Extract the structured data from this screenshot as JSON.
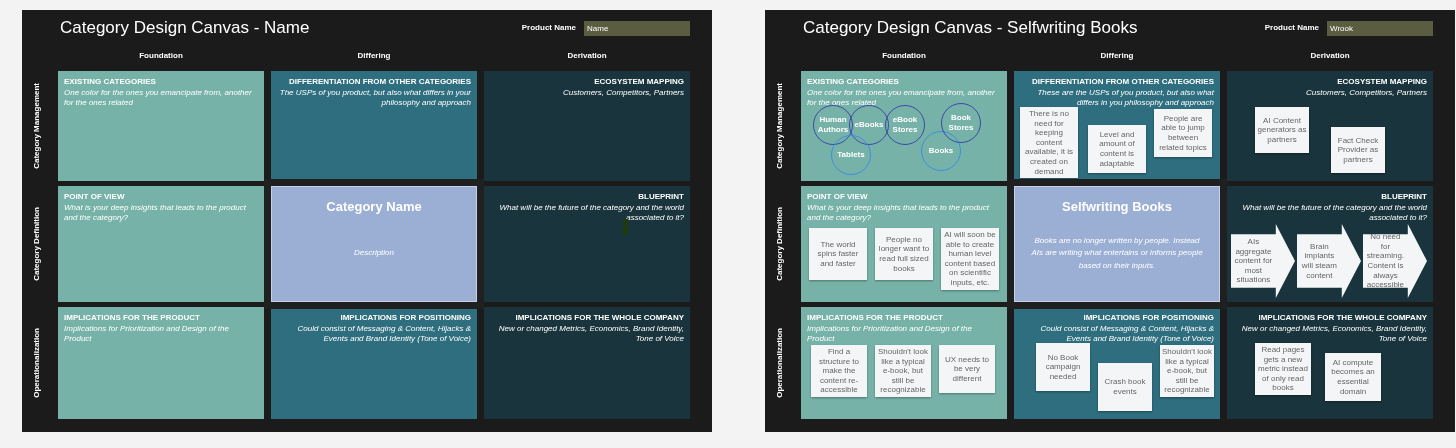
{
  "boards": [
    {
      "title": "Category Design Canvas - Name",
      "product_name": {
        "label": "Product Name",
        "value": "Name"
      },
      "columns": [
        "Foundation",
        "Differing",
        "Derivation"
      ],
      "rows": [
        {
          "label": "Category Management",
          "cells": [
            {
              "kind": "section",
              "title": "EXISTING CATEGORIES",
              "subtitle": "One color for the ones you emancipate from, another for the ones related"
            },
            {
              "kind": "section",
              "title": "DIFFERENTIATION FROM OTHER CATEGORIES",
              "subtitle": "The USPs of you product, but also what differs in your philosophy and approach"
            },
            {
              "kind": "section",
              "title": "ECOSYSTEM MAPPING",
              "subtitle": "Customers, Competitors, Partners"
            }
          ]
        },
        {
          "label": "Category Definition",
          "cells": [
            {
              "kind": "section",
              "title": "POINT OF VIEW",
              "subtitle": "What is your deep insights that leads to the product and the category?"
            },
            {
              "kind": "category",
              "name": "Category Name",
              "description": "Description"
            },
            {
              "kind": "section",
              "title": "BLUEPRINT",
              "subtitle": "What will be the future of the category and the world associated to it?",
              "marker": true
            }
          ]
        },
        {
          "label": "Operationalization",
          "cells": [
            {
              "kind": "section",
              "title": "IMPLICATIONS FOR THE PRODUCT",
              "subtitle": "Implications for Prioritization and Design of the Product"
            },
            {
              "kind": "section",
              "title": "IMPLICATIONS FOR POSITIONING",
              "subtitle": "Could consist of Messaging & Content, Hijacks & Events and Brand Identity (Tone of Voice)"
            },
            {
              "kind": "section",
              "title": "IMPLICATIONS FOR THE WHOLE COMPANY",
              "subtitle": "New or changed Metrics, Economics, Brand Identity, Tone of Voice"
            }
          ]
        }
      ]
    },
    {
      "title": "Category Design Canvas - Selfwriting Books",
      "product_name": {
        "label": "Product Name",
        "value": "Wrook"
      },
      "columns": [
        "Foundation",
        "Differing",
        "Derivation"
      ],
      "rows": [
        {
          "label": "Category Management",
          "cells": [
            {
              "kind": "section",
              "title": "EXISTING CATEGORIES",
              "subtitle": "One color for the ones you emancipate from, another for the ones related",
              "circles": [
                {
                  "label": "Human Authors",
                  "color": "#3b4aa6"
                },
                {
                  "label": "eBooks",
                  "color": "#3b4aa6"
                },
                {
                  "label": "eBook Stores",
                  "color": "#3b4aa6"
                },
                {
                  "label": "Tablets",
                  "color": "#3d8ee0"
                },
                {
                  "label": "Books",
                  "color": "#3d8ee0"
                },
                {
                  "label": "Book Stores",
                  "color": "#3b4aa6"
                }
              ]
            },
            {
              "kind": "section",
              "title": "DIFFERENTIATION FROM OTHER CATEGORIES",
              "subtitle": "These are the USPs of you product, but also what differs in you philosophy and approach",
              "notes": [
                "There is no need for keeping content available, it is created on demand",
                "Level and amount of content is adaptable",
                "People are able to jump between related topics"
              ]
            },
            {
              "kind": "section",
              "title": "ECOSYSTEM MAPPING",
              "subtitle": "Customers, Competitors, Partners",
              "notes": [
                "AI Content generators as partners",
                "Fact Check Provider as partners"
              ]
            }
          ]
        },
        {
          "label": "Category Definition",
          "cells": [
            {
              "kind": "section",
              "title": "POINT OF VIEW",
              "subtitle": "What is your deep insights that leads to the product and the category?",
              "notes": [
                "The world spins faster and faster",
                "People no longer want to read full sized books",
                "AI will soon be able to create human level content based on scientific inputs, etc."
              ]
            },
            {
              "kind": "category",
              "name": "Selfwriting Books",
              "description": "Books are no longer written by people. Instead AIs are writing what entertains or informs people based on their inputs."
            },
            {
              "kind": "section",
              "title": "BLUEPRINT",
              "subtitle": "What will be the future of the category and the world associated to it?",
              "arrows": [
                "AIs aggregate content for most situations",
                "Brain implants will steam content",
                "No need for streaming. Content is always accessible"
              ]
            }
          ]
        },
        {
          "label": "Operationalization",
          "cells": [
            {
              "kind": "section",
              "title": "IMPLICATIONS FOR THE PRODUCT",
              "subtitle": "Implications for Prioritization and Design of the Product",
              "notes": [
                "Find a structure to make the content re-accessible",
                "Shouldn't look like a typical e-book, but still be recognizable",
                "UX needs to be very different"
              ]
            },
            {
              "kind": "section",
              "title": "IMPLICATIONS FOR POSITIONING",
              "subtitle": "Could consist of Messaging & Content, Hijacks & Events and Brand Identity (Tone of Voice)",
              "notes": [
                "No Book campaign needed",
                "Crash book events",
                "Shouldn't look like a typical e-book, but still be recognizable"
              ]
            },
            {
              "kind": "section",
              "title": "IMPLICATIONS FOR THE WHOLE COMPANY",
              "subtitle": "New or changed Metrics, Economics, Brand Identity, Tone of Voice",
              "notes": [
                "Read pages gets a new metric instead of only read books",
                "AI compute becomes an essential domain"
              ]
            }
          ]
        }
      ]
    }
  ]
}
